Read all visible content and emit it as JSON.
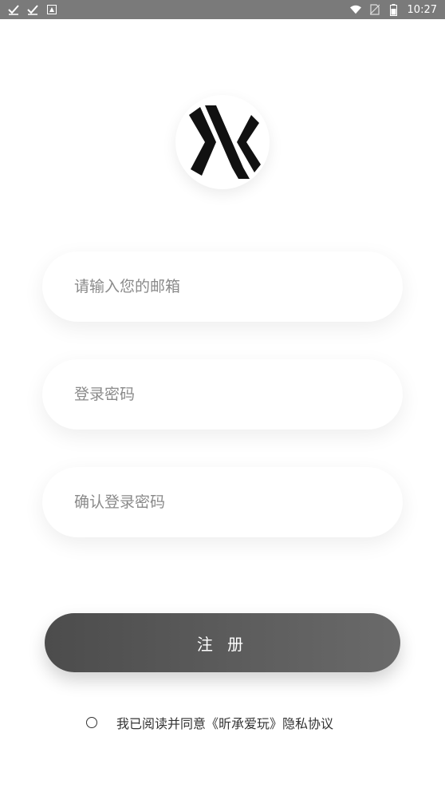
{
  "status_bar": {
    "time": "10:27",
    "left_icons": [
      "check-download-icon",
      "check-download-icon",
      "app-notification-icon"
    ],
    "right_icons": [
      "wifi-icon",
      "no-sim-icon",
      "battery-icon"
    ],
    "bg_color": "#7a7a7a"
  },
  "logo": {
    "icon": "brand-x-logo-icon"
  },
  "form": {
    "email_placeholder": "请输入您的邮箱",
    "password_placeholder": "登录密码",
    "confirm_placeholder": "确认登录密码",
    "email_value": "",
    "password_value": "",
    "confirm_value": ""
  },
  "register_button": {
    "label": "注 册",
    "color_start": "#4c4c4c",
    "color_end": "#6a6a6a"
  },
  "agreement": {
    "text": "我已阅读并同意《昕承爱玩》隐私协议",
    "checked": false
  }
}
